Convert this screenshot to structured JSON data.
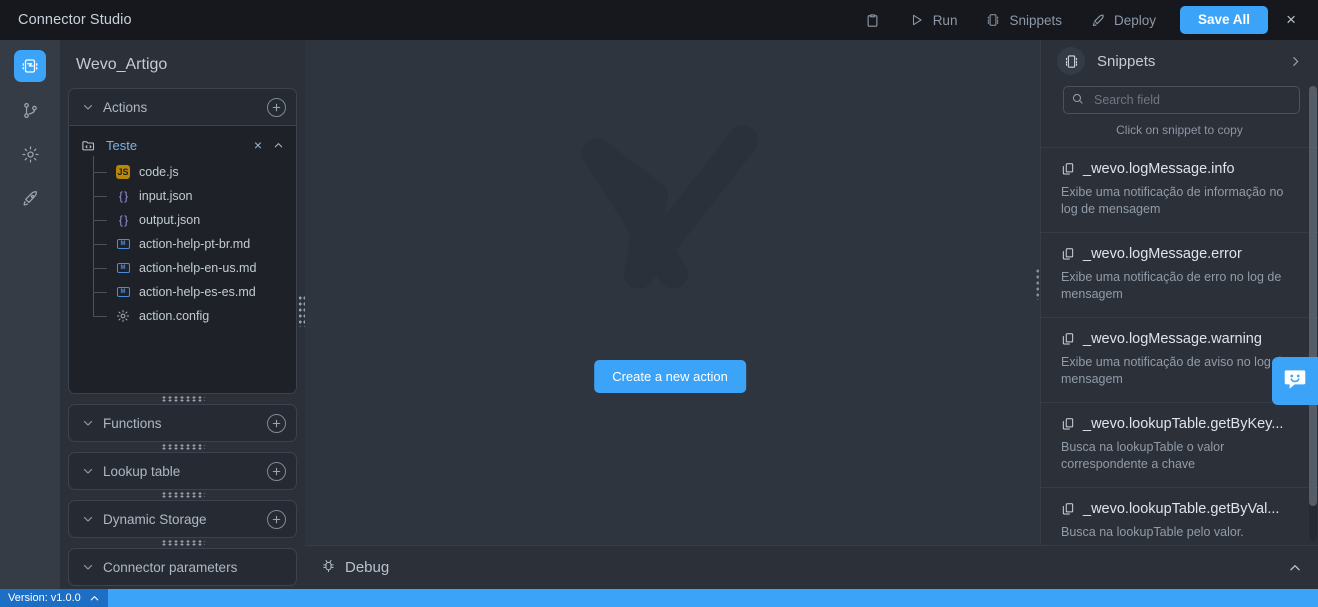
{
  "titlebar": {
    "title": "Connector Studio",
    "actions": [
      {
        "label": "",
        "icon": "clipboard-icon",
        "name": "clipboard-button"
      },
      {
        "label": "Run",
        "icon": "play-icon",
        "name": "run-button"
      },
      {
        "label": "Snippets",
        "icon": "snippets-icon",
        "name": "snippets-button"
      },
      {
        "label": "Deploy",
        "icon": "deploy-icon",
        "name": "deploy-button"
      }
    ],
    "save_label": "Save All",
    "close_label": "×"
  },
  "rail": {
    "items": [
      {
        "name": "connector-icon",
        "active": true
      },
      {
        "name": "git-branch-icon",
        "active": false
      },
      {
        "name": "gear-icon",
        "active": false
      },
      {
        "name": "rocket-icon",
        "active": false
      }
    ]
  },
  "left_panel": {
    "project_title": "Wevo_Artigo",
    "sections": [
      {
        "title": "Actions",
        "expanded": true,
        "has_add": true
      },
      {
        "title": "Functions",
        "expanded": false,
        "has_add": true
      },
      {
        "title": "Lookup table",
        "expanded": false,
        "has_add": true
      },
      {
        "title": "Dynamic Storage",
        "expanded": false,
        "has_add": true
      },
      {
        "title": "Connector parameters",
        "expanded": false,
        "has_add": false
      }
    ],
    "tree": {
      "root_label": "Teste",
      "root_icon": "folder-code-icon",
      "close_label": "×",
      "files": [
        {
          "label": "code.js",
          "icon": "js-file-icon",
          "badge": "JS"
        },
        {
          "label": "input.json",
          "icon": "json-file-icon",
          "badge": "{ }"
        },
        {
          "label": "output.json",
          "icon": "json-file-icon",
          "badge": "{ }"
        },
        {
          "label": "action-help-pt-br.md",
          "icon": "md-file-icon",
          "badge": "M↓"
        },
        {
          "label": "action-help-en-us.md",
          "icon": "md-file-icon",
          "badge": "M↓"
        },
        {
          "label": "action-help-es-es.md",
          "icon": "md-file-icon",
          "badge": "M↓"
        },
        {
          "label": "action.config",
          "icon": "gear-file-icon",
          "badge": ""
        }
      ]
    }
  },
  "canvas": {
    "watermark": "wevo-w-logo",
    "create_button": "Create a new action"
  },
  "debug": {
    "label": "Debug",
    "icon": "bug-icon"
  },
  "snippets_panel": {
    "title": "Snippets",
    "icon": "snippets-icon",
    "collapse_icon": "chevron-right-icon",
    "search_placeholder": "Search field",
    "hint": "Click on snippet to copy",
    "items": [
      {
        "name": "_wevo.logMessage.info",
        "description": "Exibe uma notificação de informação no log de mensagem"
      },
      {
        "name": "_wevo.logMessage.error",
        "description": "Exibe uma notificação de erro no log de mensagem"
      },
      {
        "name": "_wevo.logMessage.warning",
        "description": "Exibe uma notificação de aviso no log de mensagem"
      },
      {
        "name": "_wevo.lookupTable.getByKey...",
        "description": "Busca na lookupTable o valor correspondente a chave"
      },
      {
        "name": "_wevo.lookupTable.getByVal...",
        "description": "Busca na lookupTable pelo valor."
      }
    ]
  },
  "statusbar": {
    "version": "Version: v1.0.0"
  },
  "colors": {
    "accent": "#3ba3f8",
    "titlebar_bg": "#16181d",
    "panel_bg": "#2b3039",
    "canvas_bg": "#2f353f",
    "rail_bg": "#363c46",
    "tree_bg": "#1e2228",
    "version_chip": "#1c6fc4"
  }
}
